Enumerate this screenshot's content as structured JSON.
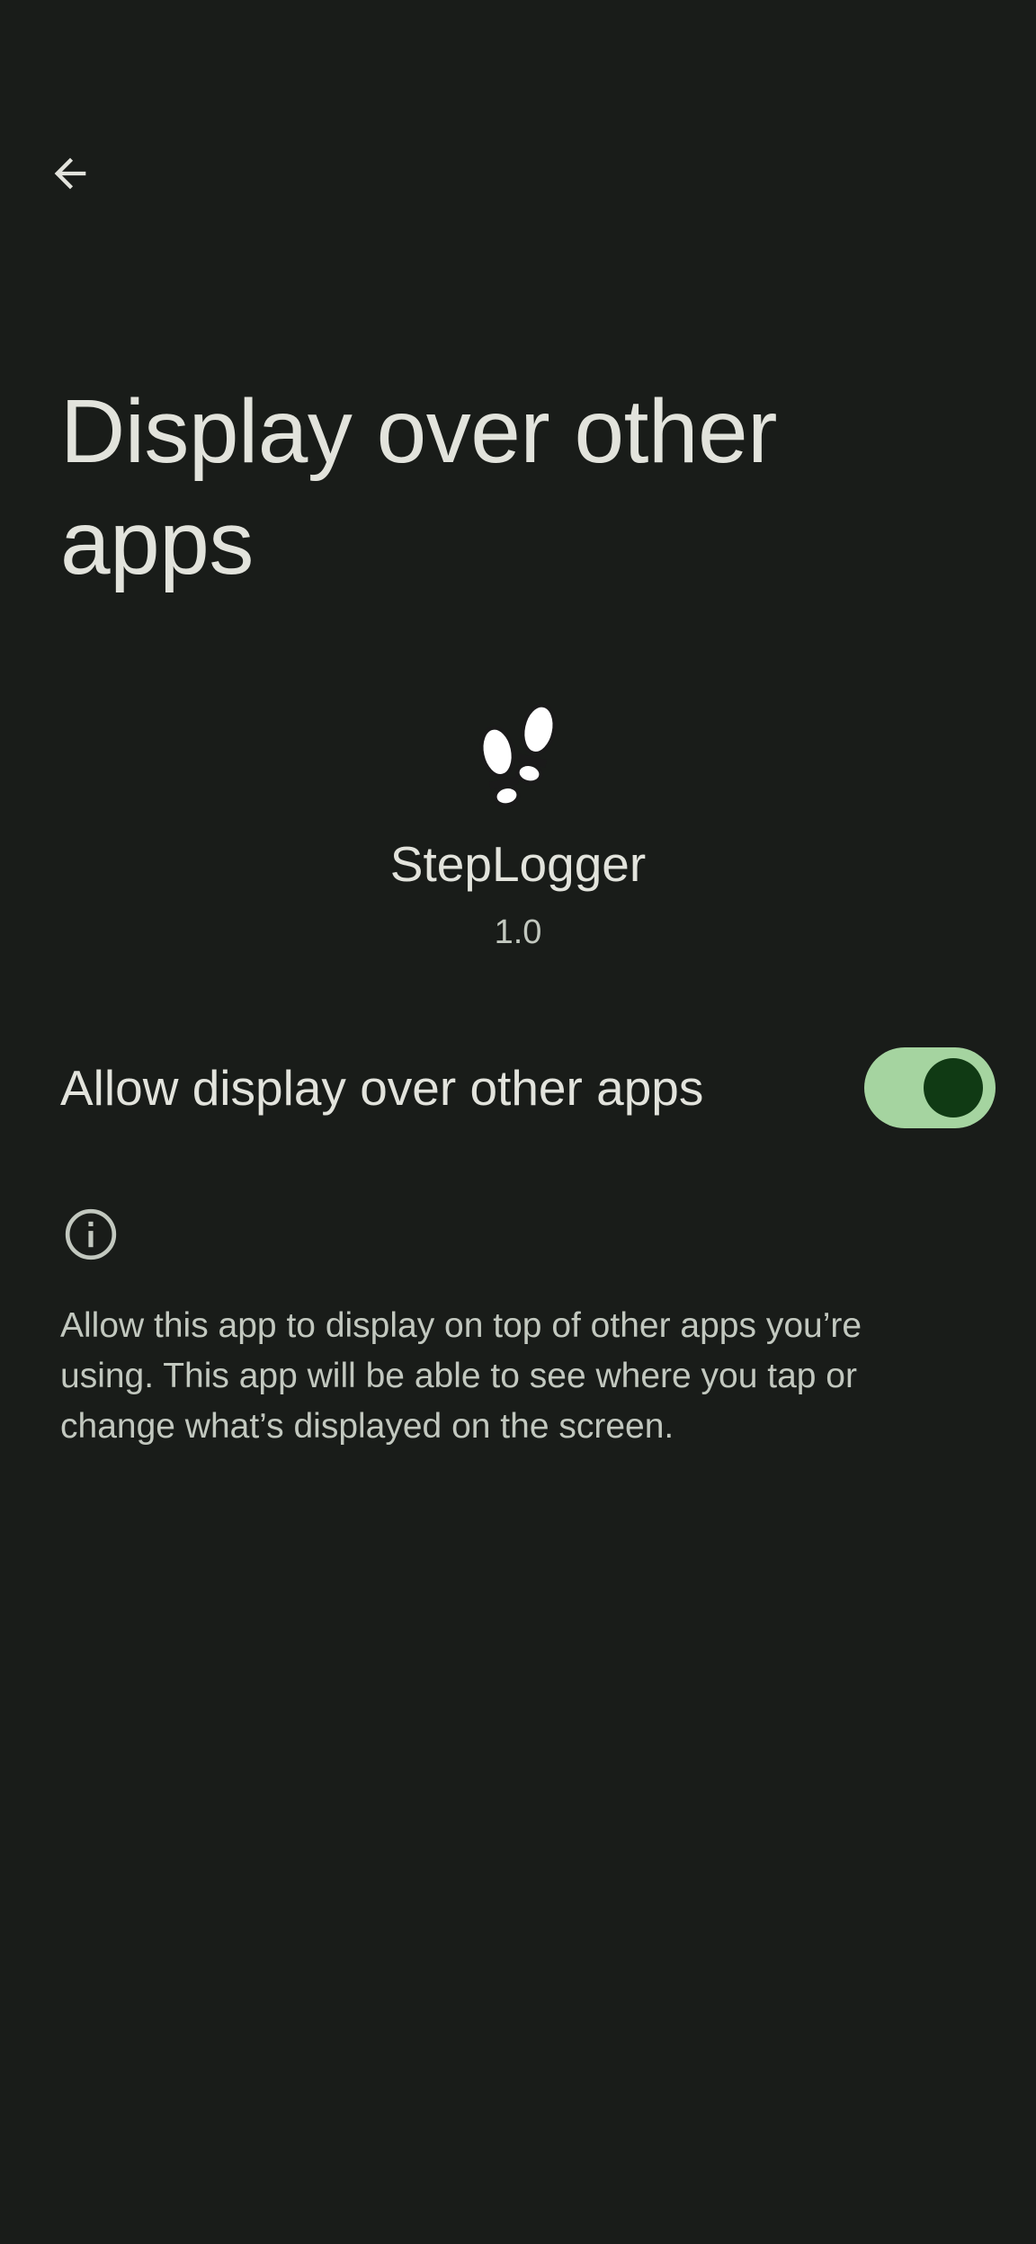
{
  "toolbar": {
    "back_icon": "arrow-back-icon"
  },
  "page": {
    "title": "Display over other apps"
  },
  "app": {
    "icon": "footprints-icon",
    "name": "StepLogger",
    "version": "1.0"
  },
  "permission": {
    "label": "Allow display over other apps",
    "enabled": true
  },
  "footer": {
    "icon": "info-icon",
    "text": "Allow this app to display on top of other apps you’re using. This app will be able to see where you tap or change what’s displayed on the screen."
  },
  "colors": {
    "background": "#191c19",
    "text_primary": "#e2e3dc",
    "text_secondary": "#c2c8bf",
    "switch_track": "#a5d4a0",
    "switch_thumb": "#103a14"
  }
}
